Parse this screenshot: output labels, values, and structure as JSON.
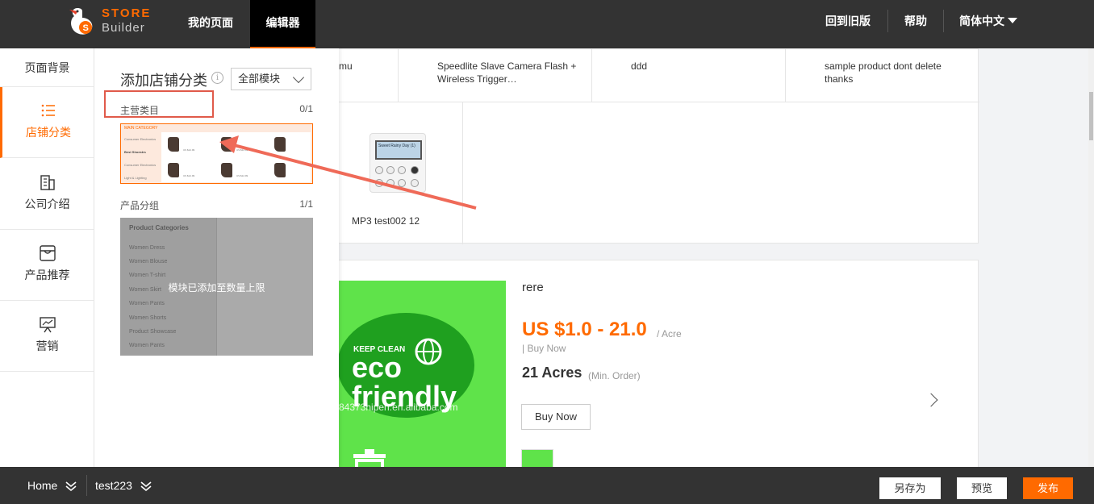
{
  "topbar": {
    "logo_line1": "STORE",
    "logo_line2": "Builder",
    "nav": {
      "my_page": "我的页面",
      "editor": "编辑器"
    },
    "right": {
      "old_version": "回到旧版",
      "help": "帮助",
      "language": "简体中文"
    }
  },
  "sidebar": {
    "items": [
      {
        "label": "页面背景",
        "icon": ""
      },
      {
        "label": "店铺分类",
        "icon": "list-icon"
      },
      {
        "label": "公司介绍",
        "icon": "building-icon"
      },
      {
        "label": "产品推荐",
        "icon": "box-icon"
      },
      {
        "label": "营销",
        "icon": "presentation-icon"
      }
    ]
  },
  "panel": {
    "title": "添加店铺分类",
    "info": "i",
    "module_select": "全部模块",
    "group_main": {
      "label": "主营类目",
      "count": "0/1"
    },
    "group_products": {
      "label": "产品分组",
      "count": "1/1"
    },
    "main_thumb": {
      "header": "MAIN CATEGORY",
      "side": [
        "Consumer Electronics",
        "Best Shoestrs",
        "Consumer Electronics",
        "Light & Lighting"
      ],
      "product_price": "US $12.99"
    },
    "group_thumb": {
      "head": "Product Categories",
      "items": [
        "Women Dress",
        "Women Blouse",
        "Women T-shirt",
        "Women Skirt",
        "Women Pants",
        "Women Shorts",
        "Product Showcase",
        "Women Pants"
      ],
      "overlay": "模块已添加至数量上限"
    }
  },
  "canvas": {
    "top_products": [
      "mu",
      "Speedlite Slave Camera Flash + Wireless Trigger…",
      "ddd",
      "sample product dont delete thanks"
    ],
    "mp3_label": "MP3 test002 12",
    "mp3_screen": "Sweet Rainy Day (1)",
    "product": {
      "name": "rere",
      "price": "US $1.0 - 21.0",
      "price_unit": "/ Acre",
      "buy_link": "| Buy Now",
      "moq": "21 Acres",
      "moq_sub": "(Min. Order)",
      "buy_button": "Buy Now",
      "image_keep": "KEEP CLEAN",
      "image_word": "eco friendly",
      "watermark": "84373hipen.en.alibaba.com"
    }
  },
  "bottombar": {
    "home": "Home",
    "page": "test223",
    "save_as": "另存为",
    "preview": "预览",
    "publish": "发布"
  },
  "colors": {
    "accent": "#ff6a00",
    "topbar": "#333333",
    "annotation": "#e05a4a"
  }
}
